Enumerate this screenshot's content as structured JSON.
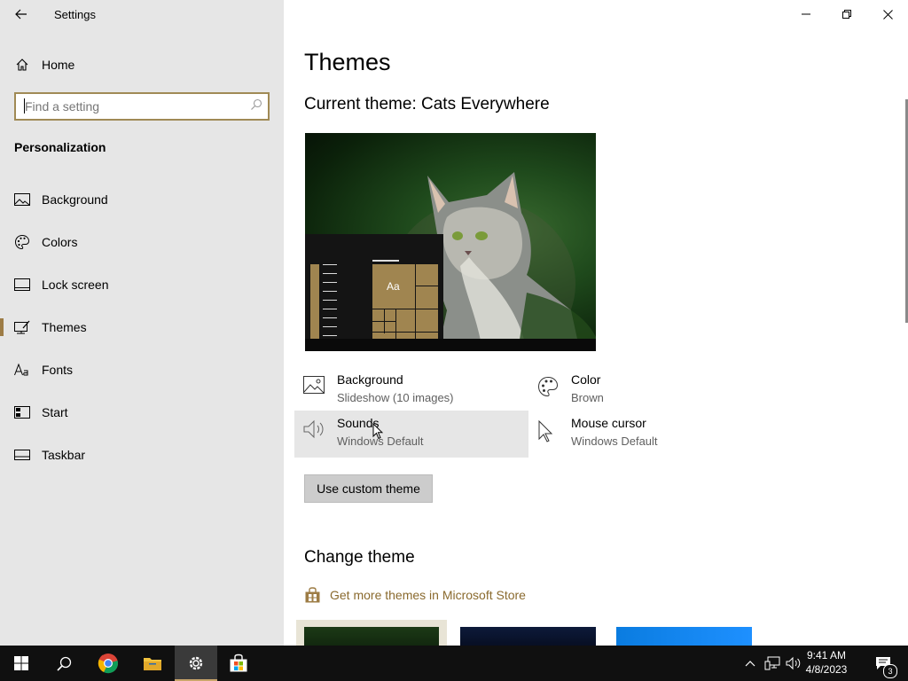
{
  "window": {
    "title": "Settings"
  },
  "sidebar": {
    "home_label": "Home",
    "search_placeholder": "Find a setting",
    "section_title": "Personalization",
    "items": [
      {
        "label": "Background",
        "icon": "picture-icon"
      },
      {
        "label": "Colors",
        "icon": "palette-icon"
      },
      {
        "label": "Lock screen",
        "icon": "lock-screen-icon"
      },
      {
        "label": "Themes",
        "icon": "themes-icon",
        "active": true
      },
      {
        "label": "Fonts",
        "icon": "fonts-icon"
      },
      {
        "label": "Start",
        "icon": "start-icon"
      },
      {
        "label": "Taskbar",
        "icon": "taskbar-icon"
      }
    ]
  },
  "main": {
    "page_title": "Themes",
    "current_theme": "Current theme: Cats Everywhere",
    "preview_tile_text": "Aa",
    "properties": [
      {
        "title": "Background",
        "subtitle": "Slideshow (10 images)",
        "icon": "picture-icon"
      },
      {
        "title": "Color",
        "subtitle": "Brown",
        "icon": "palette-icon"
      },
      {
        "title": "Sounds",
        "subtitle": "Windows Default",
        "icon": "speaker-icon"
      },
      {
        "title": "Mouse cursor",
        "subtitle": "Windows Default",
        "icon": "cursor-icon"
      }
    ],
    "custom_theme_button": "Use custom theme",
    "change_theme_title": "Change theme",
    "store_link": "Get more themes in Microsoft Store"
  },
  "taskbar": {
    "time": "9:41 AM",
    "date": "4/8/2023",
    "notification_count": "3"
  },
  "colors": {
    "accent": "#9d7c45",
    "sidebar_bg": "#e6e6e6",
    "taskbar_bg": "#101010",
    "link": "#8a6a2e"
  }
}
